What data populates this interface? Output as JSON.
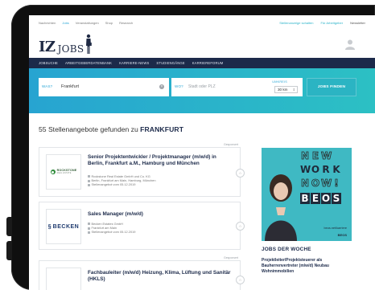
{
  "top_links": {
    "left": [
      "Nachrichten",
      "Jobs",
      "Veranstaltungen",
      "Shop",
      "Research"
    ],
    "active_index": 1,
    "right_alert": "Stellenanzeige schalten",
    "right_arbeitgeber": "Für Arbeitgeber",
    "right_newsletter": "Newsletter"
  },
  "logo": {
    "iz": "IZ",
    "jobs": "JOBS"
  },
  "nav": [
    "Jobsuche",
    "Arbeitgeberdatenbank",
    "Karriere-News",
    "Studiengänge",
    "Karriereforum"
  ],
  "search": {
    "what_label": "WAS?",
    "what_value": "Frankfurt",
    "where_label": "WO?",
    "where_placeholder": "Stadt oder PLZ",
    "radius_label": "UMKREIS",
    "radius_value": "30 km",
    "find_button": "JOBS FINDEN"
  },
  "result": {
    "count_text": "55 Stellenangebote gefunden zu",
    "query": "FRANKFURT"
  },
  "sponsored_label": "Gesponsert",
  "jobs": [
    {
      "title": "Senior Projektentwickler / Projektmanager (m/w/d) in Berlin, Frankfurt a.M., Hamburg und München",
      "company": "Rockstone Real Estate GmbH und Co. KG",
      "location": "Berlin, Frankfurt am Main, Hamburg, München",
      "date": "Stellenangebot vom 05.12.2019",
      "logo_text": "ROCKSTONE",
      "logo_sub": "REAL ESTATE"
    },
    {
      "title": "Sales Manager (m/w/d)",
      "company": "Becken Estates GmbH",
      "location": "Frankfurt am Main",
      "date": "Stellenangebot vom 05.12.2019",
      "logo_text": "BECKEN"
    },
    {
      "title": "Fachbauleiter (m/w/d) Heizung, Klima, Lüftung und Sanitär (HKLS)"
    }
  ],
  "ad": {
    "row1": [
      "N",
      "E",
      "W"
    ],
    "row2": [
      "W",
      "O",
      "R",
      "K"
    ],
    "row3": [
      "N",
      "O",
      "W",
      "!"
    ],
    "row4": [
      "B",
      "E",
      "O",
      "S"
    ],
    "url": "beos.net/karriere",
    "brand": "BEOS"
  },
  "jobs_der_woche": {
    "title": "JOBS DER WOCHE",
    "item": "Projektleiter/Projektsteuerer als Bauherrenvertreter (m/w/d) Neubau Wohnimmobilien"
  },
  "colors": {
    "navy": "#1c2a4a",
    "teal_start": "#27a4d1",
    "teal_end": "#2cc0c4",
    "button": "#2bb4c3",
    "ad_bg": "#3fb9c3"
  }
}
